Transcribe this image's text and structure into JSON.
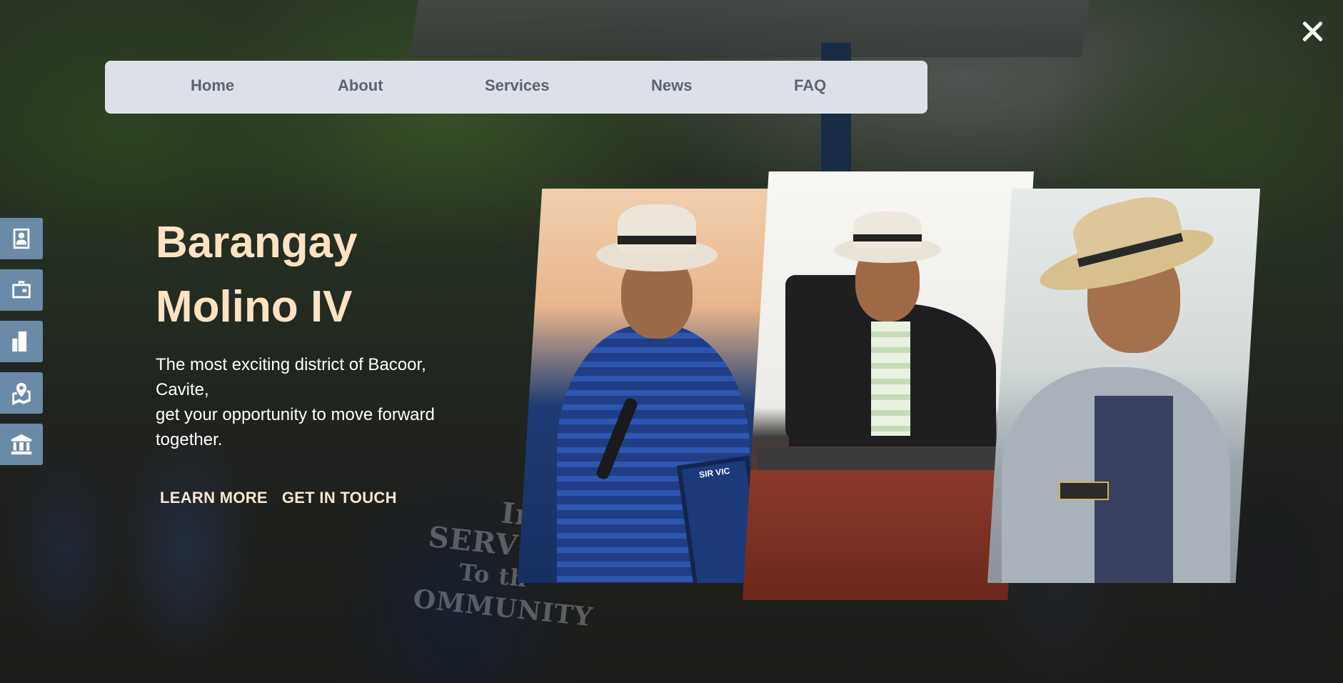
{
  "nav": {
    "items": [
      {
        "label": "Home"
      },
      {
        "label": "About"
      },
      {
        "label": "Services"
      },
      {
        "label": "News"
      },
      {
        "label": "FAQ"
      }
    ]
  },
  "hero": {
    "title_line1": "Barangay",
    "title_line2": "Molino IV",
    "subtitle_line1": "The most exciting district of Bacoor,",
    "subtitle_line2": "Cavite,",
    "subtitle_line3": "get your opportunity to move forward",
    "subtitle_line4": "together.",
    "learn_more": "LEARN MORE",
    "get_in_touch": "GET IN TOUCH"
  },
  "background": {
    "shirt_text_line1": "In",
    "shirt_text_line2": "SERV",
    "shirt_text_line3": "To th",
    "shirt_text_line4": "OMMUNITY",
    "plaque_text": "SIR VIC"
  },
  "side_icons": [
    {
      "icon": "id-card-icon"
    },
    {
      "icon": "briefcase-icon"
    },
    {
      "icon": "building-icon"
    },
    {
      "icon": "map-icon"
    },
    {
      "icon": "government-building-icon"
    }
  ],
  "colors": {
    "nav_background": "#dde1e7",
    "nav_text": "#5a6473",
    "hero_title": "#fde3c3",
    "side_icon_background": "#6a8aa8"
  }
}
